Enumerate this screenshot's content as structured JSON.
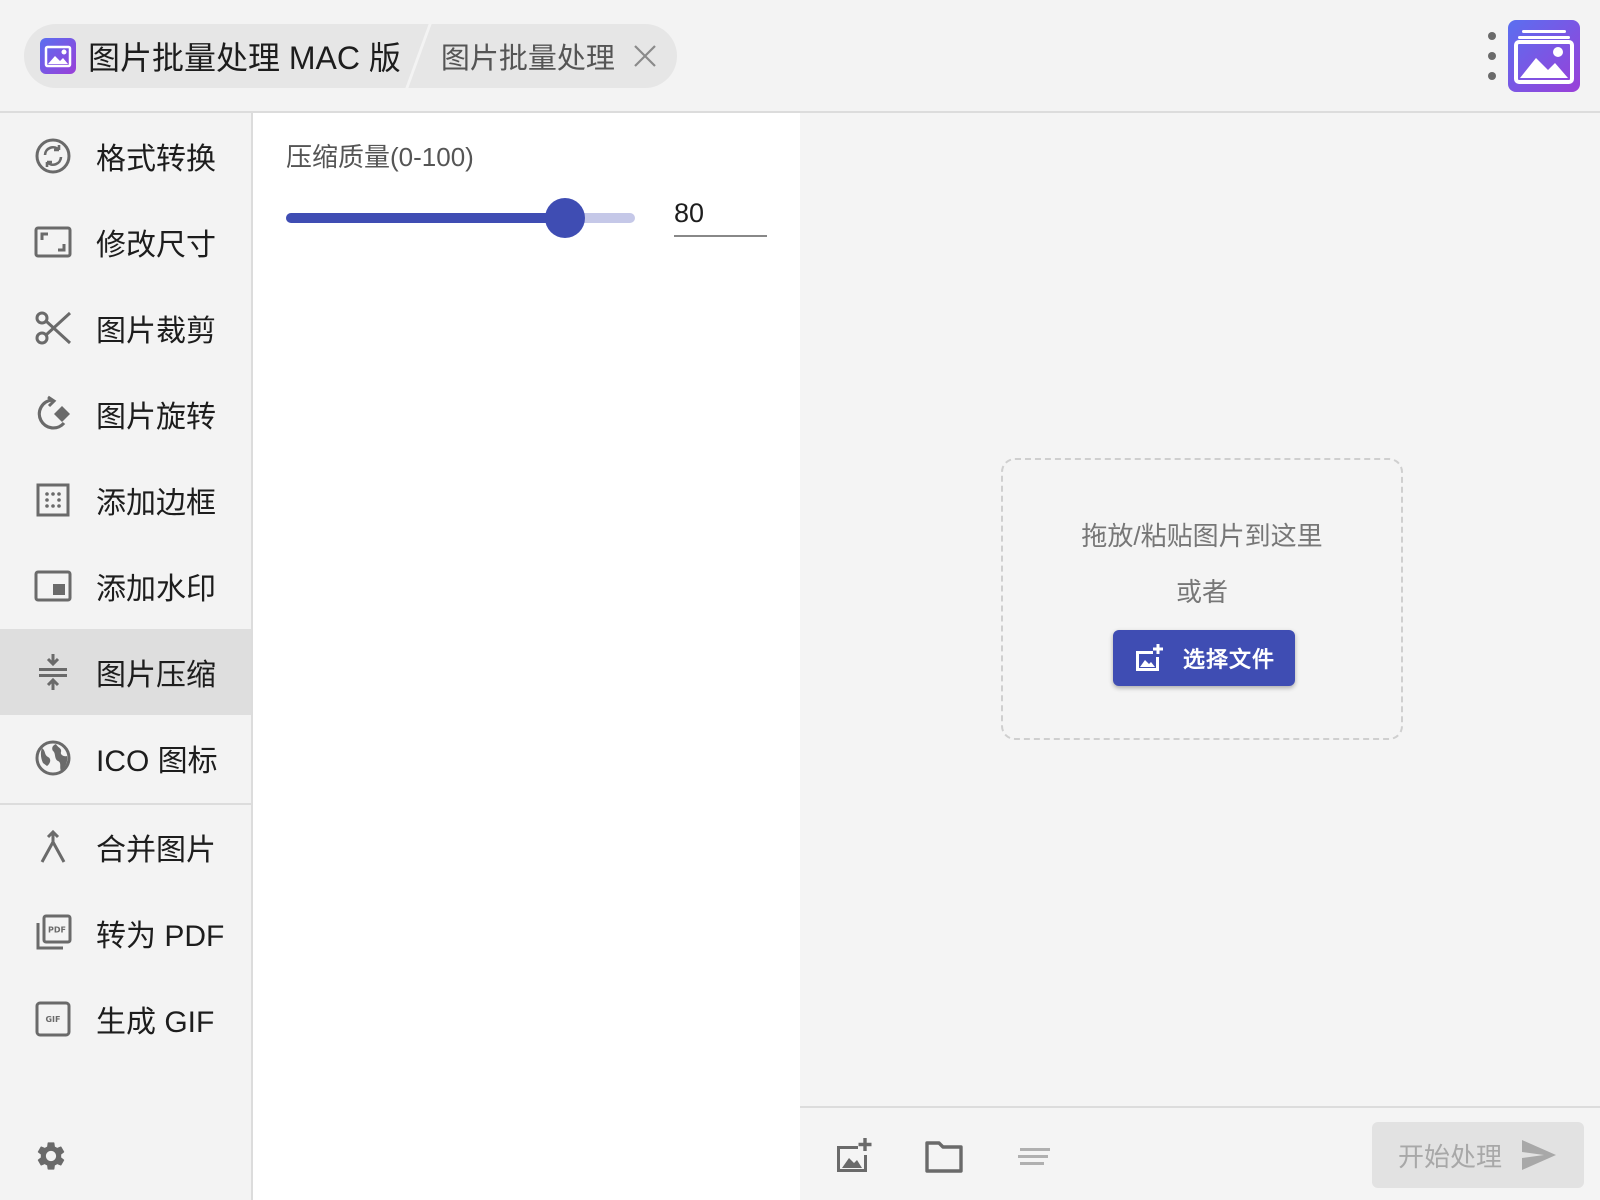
{
  "header": {
    "app_title": "图片批量处理 MAC 版",
    "tab_title": "图片批量处理"
  },
  "sidebar": {
    "items": [
      {
        "label": "格式转换",
        "icon": "convert-icon"
      },
      {
        "label": "修改尺寸",
        "icon": "resize-icon"
      },
      {
        "label": "图片裁剪",
        "icon": "scissors-icon"
      },
      {
        "label": "图片旋转",
        "icon": "rotate-icon"
      },
      {
        "label": "添加边框",
        "icon": "border-icon"
      },
      {
        "label": "添加水印",
        "icon": "watermark-icon"
      },
      {
        "label": "图片压缩",
        "icon": "compress-icon",
        "active": true
      },
      {
        "label": "ICO 图标",
        "icon": "globe-icon"
      },
      {
        "label": "合并图片",
        "icon": "merge-icon"
      },
      {
        "label": "转为 PDF",
        "icon": "pdf-icon"
      },
      {
        "label": "生成 GIF",
        "icon": "gif-icon"
      }
    ]
  },
  "options": {
    "quality_label": "压缩质量(0-100)",
    "quality_value": "80",
    "quality_min": 0,
    "quality_max": 100
  },
  "dropzone": {
    "hint": "拖放/粘贴图片到这里",
    "or": "或者",
    "select_label": "选择文件"
  },
  "toolbar": {
    "start_label": "开始处理"
  },
  "colors": {
    "accent": "#3f4db3",
    "slider_track": "#c5c8e8",
    "active_item": "#dedede",
    "logo_gradient_start": "#5a6ff0",
    "logo_gradient_end": "#9a3fd8"
  }
}
